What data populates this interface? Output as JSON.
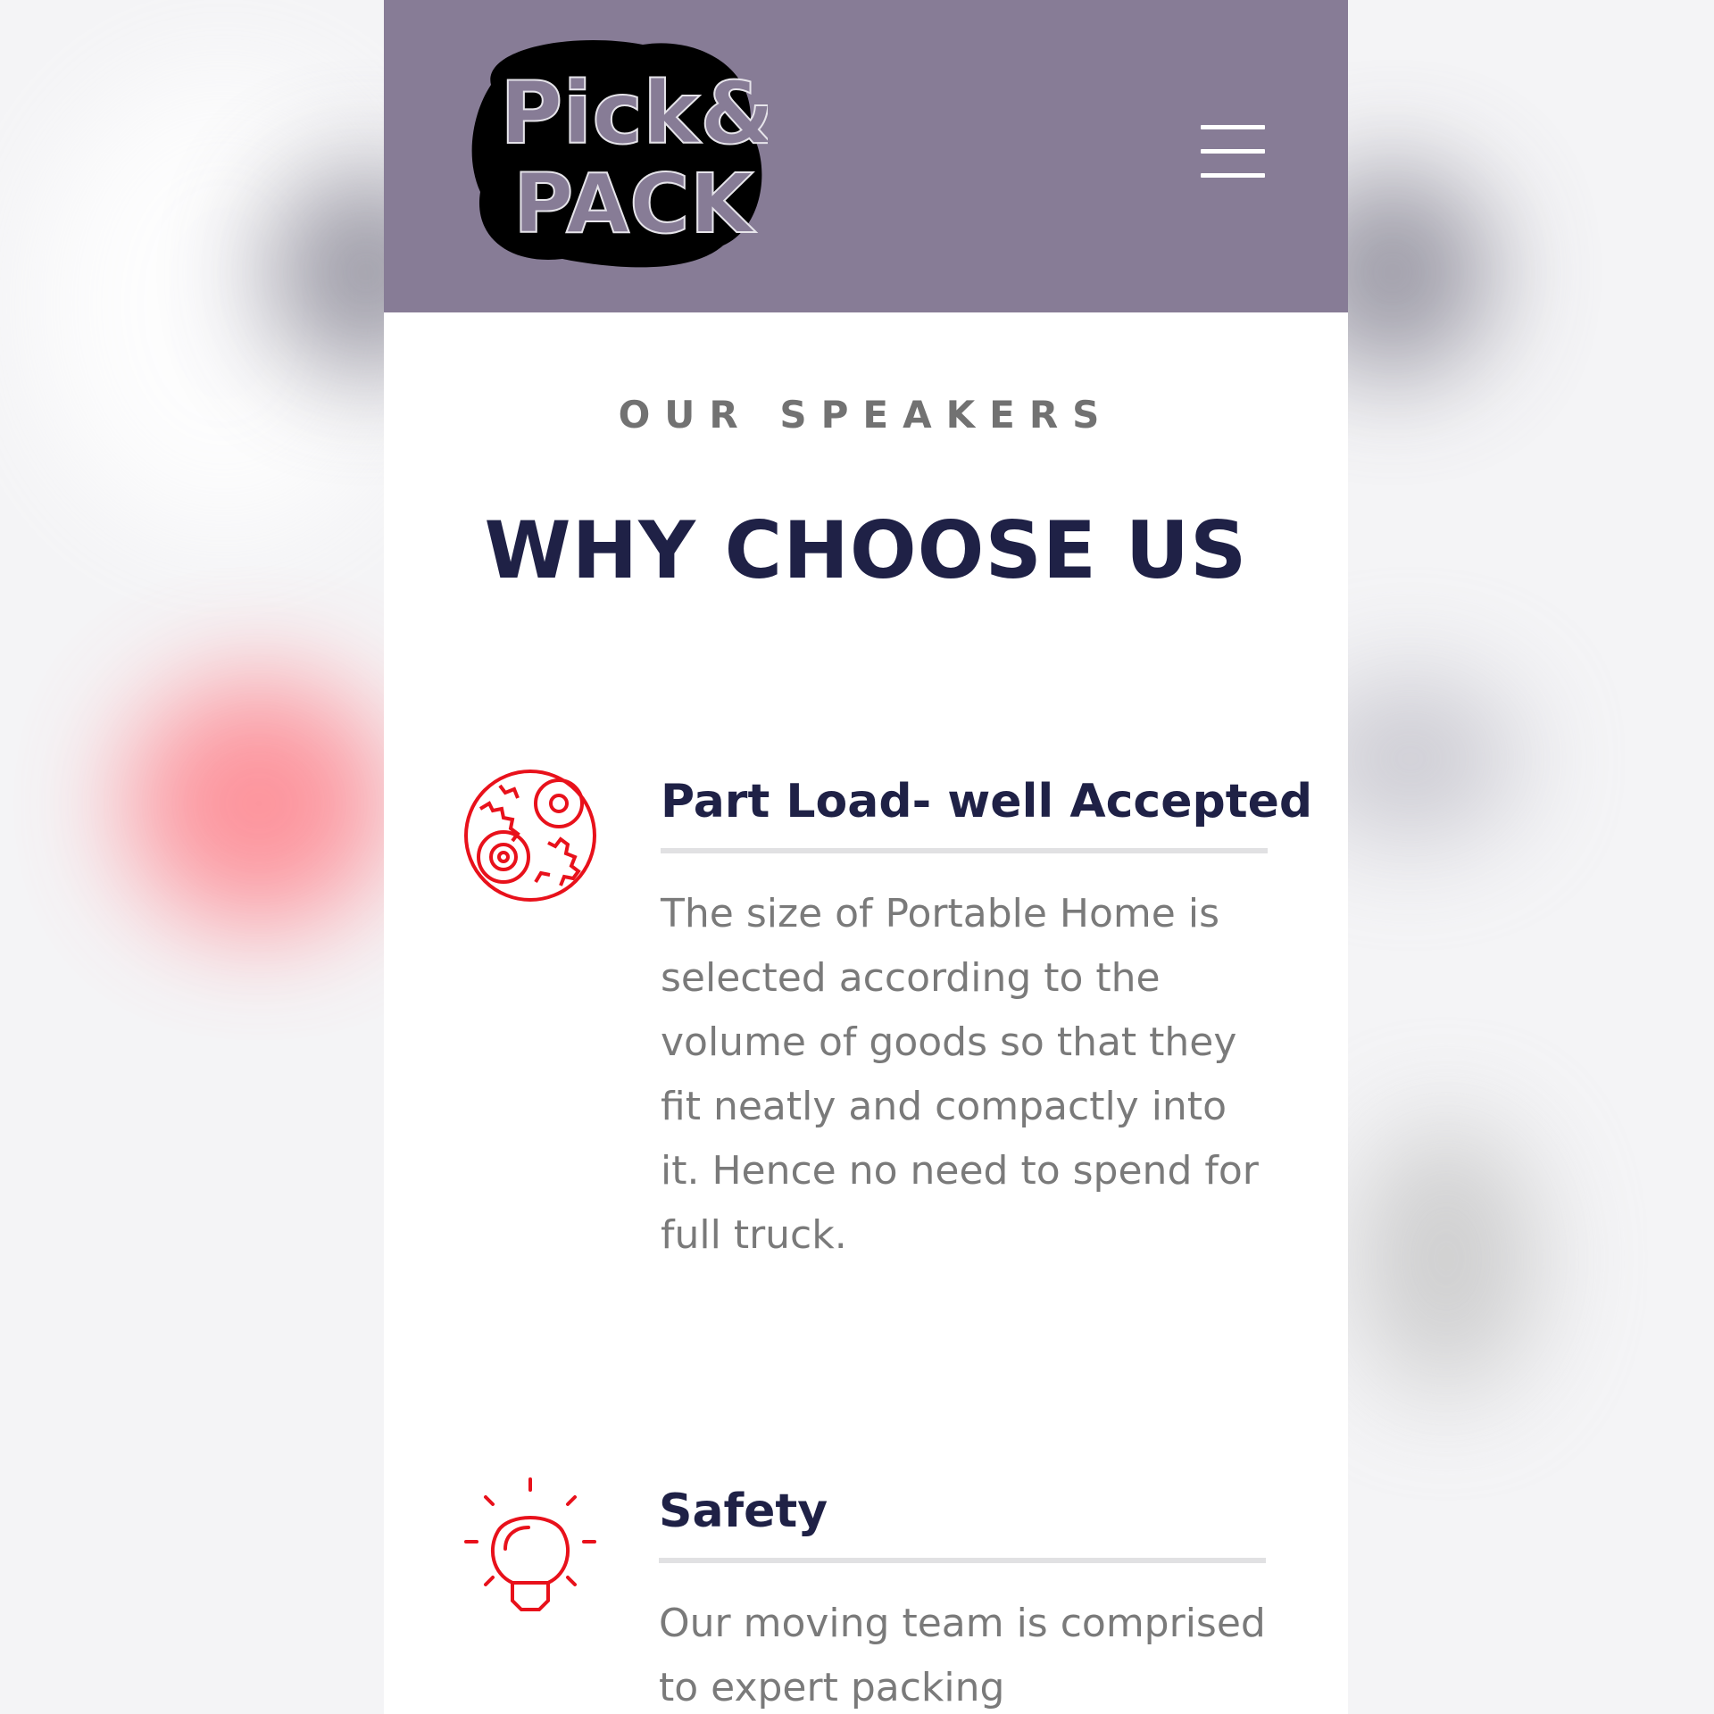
{
  "brand": {
    "logo_line1": "Pick&",
    "logo_line2": "PACK"
  },
  "header": {
    "background_color": "#877c96",
    "menu_icon": "hamburger-menu-icon"
  },
  "section": {
    "eyebrow": "OUR SPEAKERS",
    "title": "WHY CHOOSE US"
  },
  "features": [
    {
      "icon": "gears-icon",
      "heading": "Part Load- well Accepted",
      "body": "The size of Portable Home is selected according to the volume of goods so that they fit neatly and compactly into it. Hence no need to spend for full truck."
    },
    {
      "icon": "lightbulb-icon",
      "heading": "Safety",
      "body": "Our moving team is comprised to expert packing"
    }
  ],
  "colors": {
    "accent_red": "#e8111b",
    "heading_navy": "#1f2146",
    "body_gray": "#7a7a7a"
  }
}
